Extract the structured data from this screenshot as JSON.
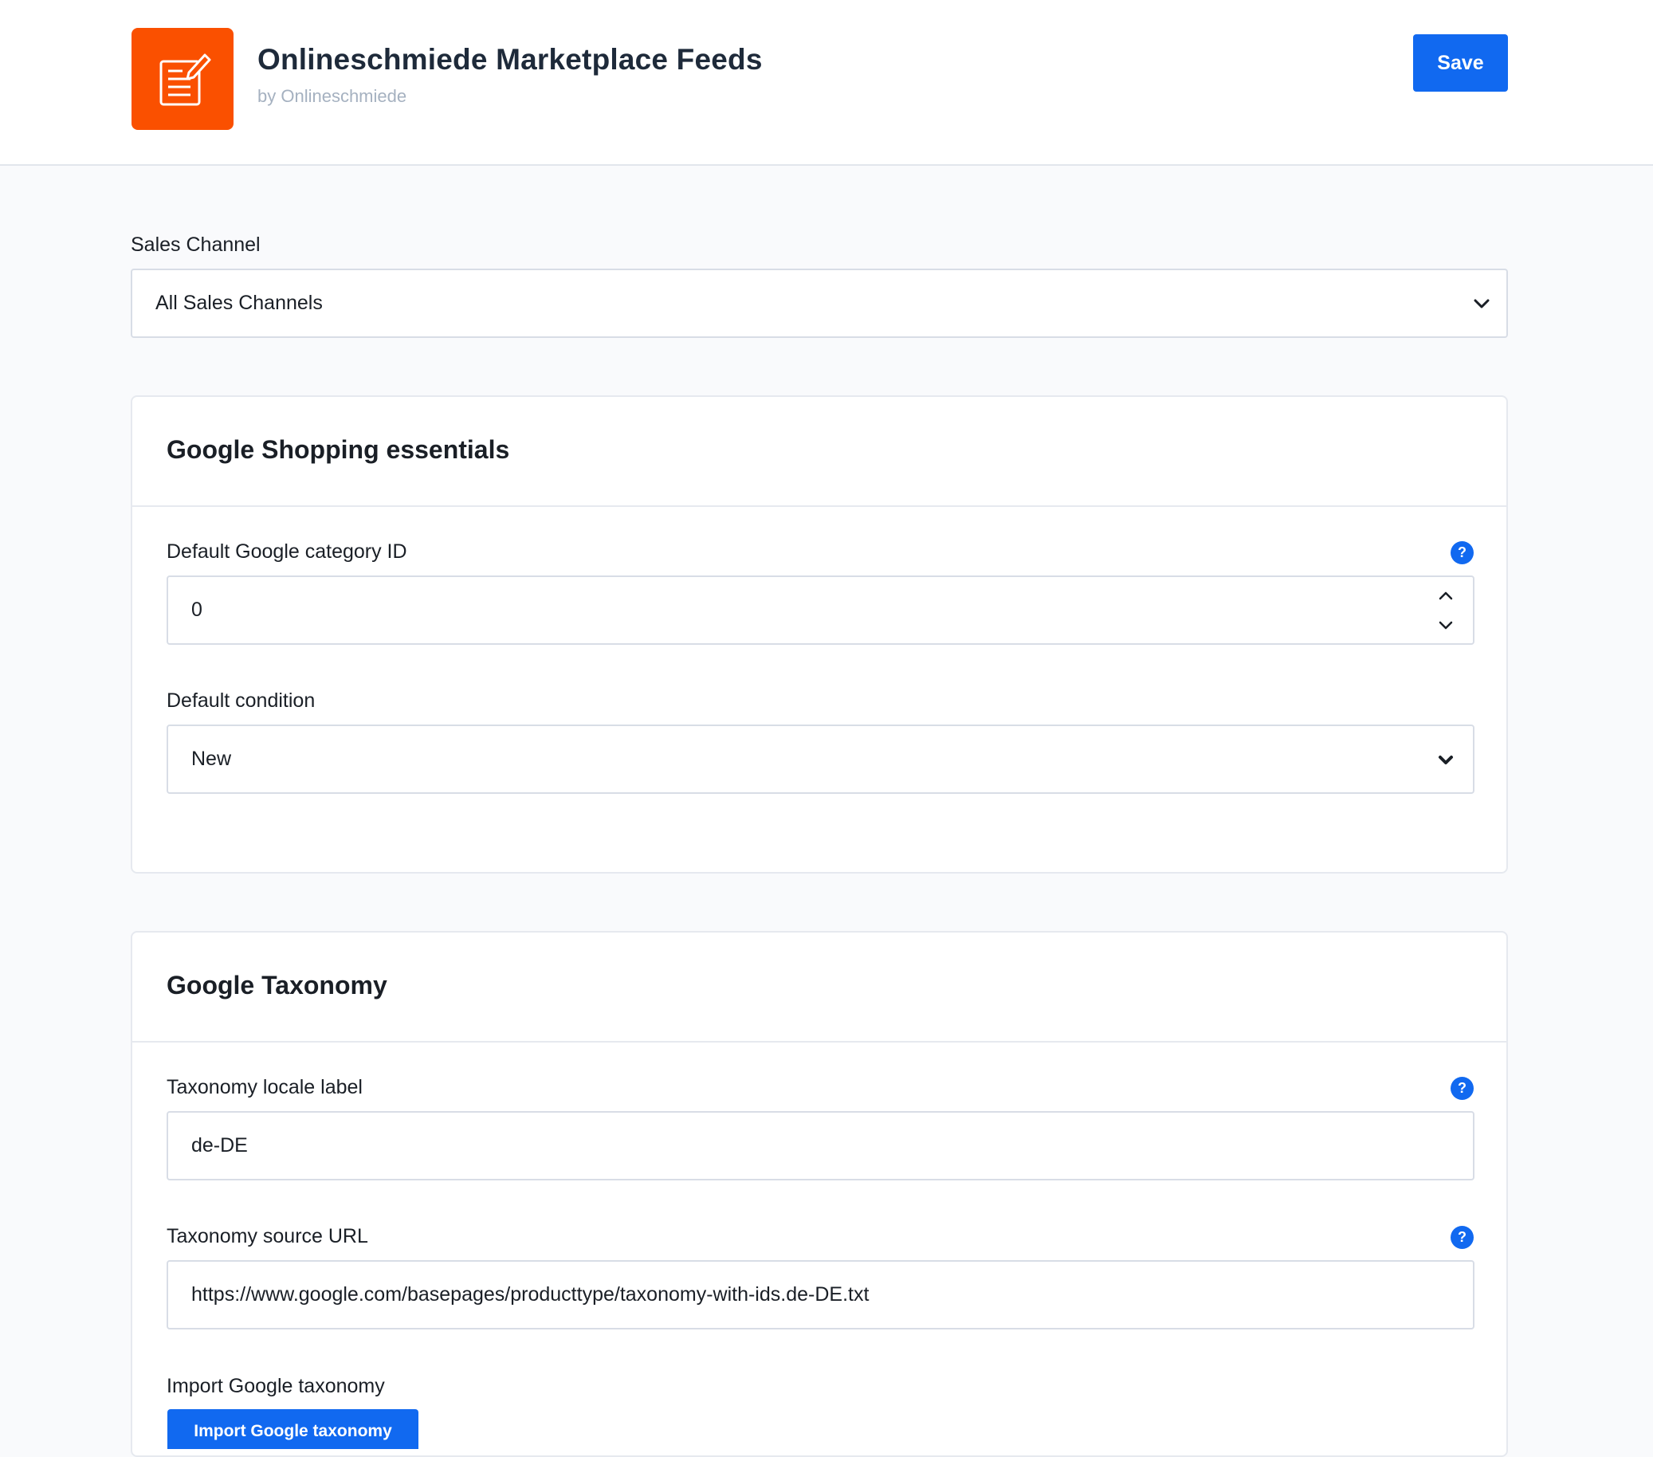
{
  "header": {
    "title": "Onlineschmiede Marketplace Feeds",
    "vendor": "by Onlineschmiede",
    "save_label": "Save"
  },
  "sales_channel": {
    "label": "Sales Channel",
    "value": "All Sales Channels"
  },
  "essentials": {
    "title": "Google Shopping essentials",
    "category_id": {
      "label": "Default Google category ID",
      "value": "0",
      "help": "?"
    },
    "condition": {
      "label": "Default condition",
      "value": "New"
    }
  },
  "taxonomy": {
    "title": "Google Taxonomy",
    "locale": {
      "label": "Taxonomy locale label",
      "value": "de-DE",
      "help": "?"
    },
    "source_url": {
      "label": "Taxonomy source URL",
      "value": "https://www.google.com/basepages/producttype/taxonomy-with-ids.de-DE.txt",
      "help": "?"
    },
    "import": {
      "label": "Import Google taxonomy",
      "button_label": "Import Google taxonomy"
    }
  },
  "colors": {
    "brand_orange": "#fa5000",
    "primary_blue": "#1169f0"
  }
}
